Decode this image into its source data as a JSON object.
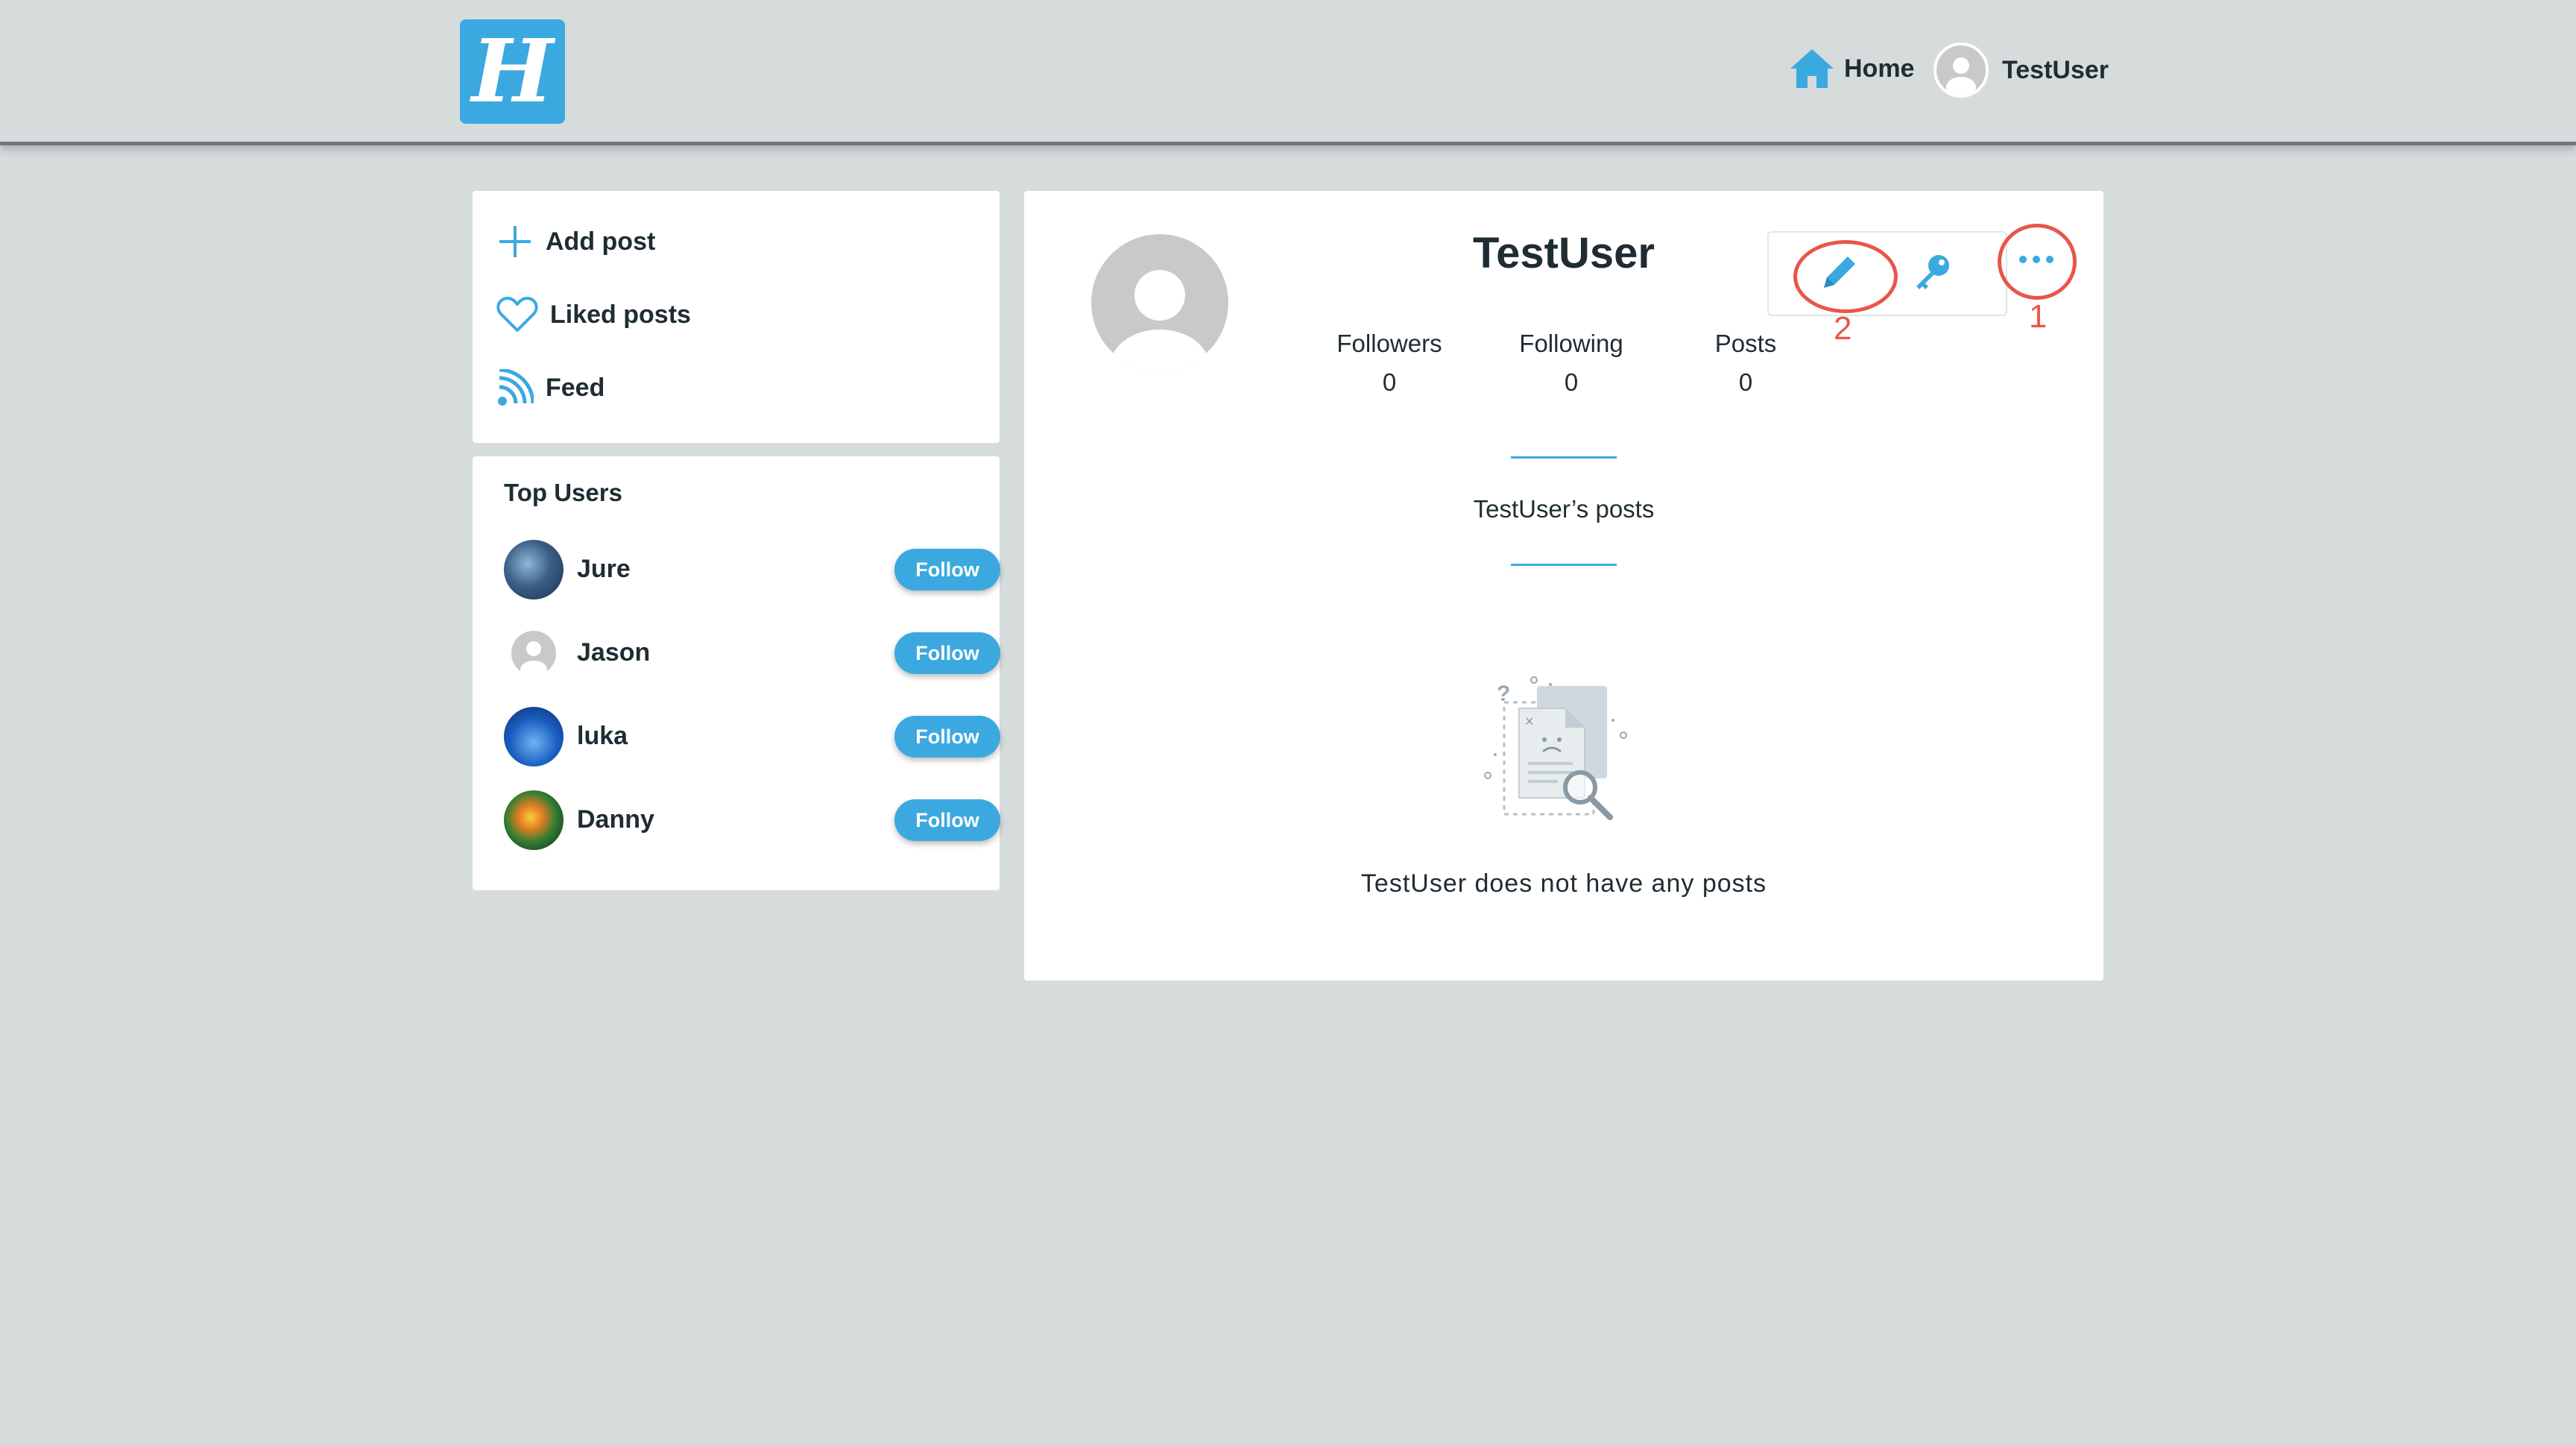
{
  "nav": {
    "logo_letter": "H",
    "home_label": "Home",
    "user_label": "TestUser"
  },
  "sidebar": {
    "items": [
      {
        "label": "Add post",
        "icon": "plus-icon"
      },
      {
        "label": "Liked posts",
        "icon": "heart-icon"
      },
      {
        "label": "Feed",
        "icon": "rss-icon"
      }
    ]
  },
  "top_users": {
    "title": "Top Users",
    "follow_label": "Follow",
    "users": [
      {
        "name": "Jure"
      },
      {
        "name": "Jason"
      },
      {
        "name": "luka"
      },
      {
        "name": "Danny"
      }
    ]
  },
  "profile": {
    "name": "TestUser",
    "stats": [
      {
        "label": "Followers",
        "value": "0"
      },
      {
        "label": "Following",
        "value": "0"
      },
      {
        "label": "Posts",
        "value": "0"
      }
    ],
    "posts_heading": "TestUser’s posts",
    "empty_message": "TestUser does not have any posts"
  },
  "annotations": {
    "edit_number": "2",
    "more_number": "1"
  },
  "colors": {
    "accent": "#3ba9e0",
    "annotation": "#e8564a",
    "background": "#d6dbdb"
  }
}
